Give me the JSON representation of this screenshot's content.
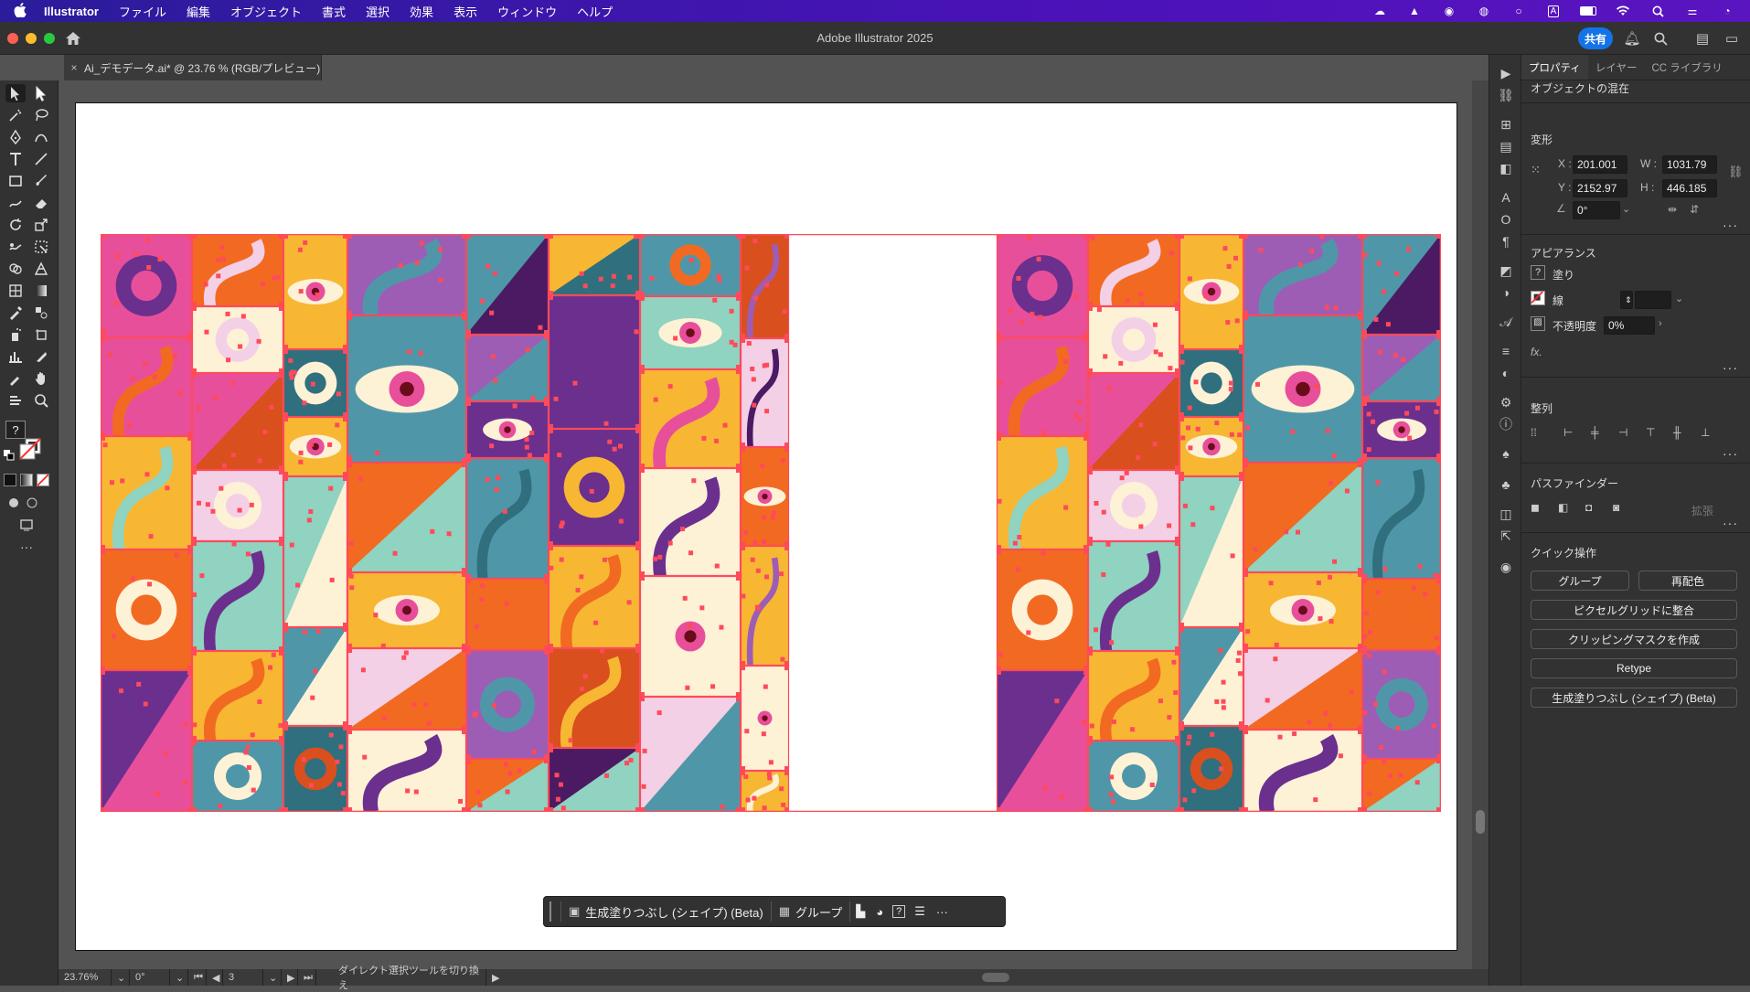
{
  "menubar": {
    "apple": "",
    "app_name": "Illustrator",
    "items": [
      "ファイル",
      "編集",
      "オブジェクト",
      "書式",
      "選択",
      "効果",
      "表示",
      "ウィンドウ",
      "ヘルプ"
    ]
  },
  "titlebar": {
    "title": "Adobe Illustrator 2025",
    "share_label": "共有"
  },
  "document_tab": {
    "close": "×",
    "name": "Ai_デモデータ.ai* @ 23.76 % (RGB/プレビュー)"
  },
  "context_bar": {
    "generative_fill": "生成塗りつぶし (シェイプ) (Beta)",
    "group": "グループ"
  },
  "status": {
    "zoom": "23.76%",
    "rotation": "0°",
    "artboard": "3",
    "tool_hint": "ダイレクト選択ツールを切り換え"
  },
  "panel": {
    "tabs": [
      "プロパティ",
      "レイヤー",
      "CC ライブラリ"
    ],
    "selection_type": "オブジェクトの混在",
    "transform": {
      "title": "変形",
      "x_label": "X :",
      "x_value": "201.001",
      "y_label": "Y :",
      "y_value": "2152.97",
      "w_label": "W :",
      "w_value": "1031.79",
      "h_label": "H :",
      "h_value": "446.185",
      "angle_value": "0°"
    },
    "appearance": {
      "title": "アピアランス",
      "fill_label": "塗り",
      "stroke_label": "線",
      "opacity_label": "不透明度",
      "opacity_value": "0%",
      "fx": "fx."
    },
    "align": {
      "title": "整列"
    },
    "pathfinder": {
      "title": "パスファインダー",
      "expand": "拡張"
    },
    "quick_actions": {
      "title": "クイック操作",
      "group": "グループ",
      "recolor": "再配色",
      "pixel_grid": "ピクセルグリッドに整合",
      "clipping_mask": "クリッピングマスクを作成",
      "retype": "Retype",
      "generative_fill": "生成塗りつぶし (シェイプ) (Beta)"
    }
  },
  "colors": {
    "accent": "#1473e6",
    "selection": "#ff4a5a",
    "orange": "#f26a21",
    "purple": "#6b2f8e",
    "teal": "#2f6f7e",
    "mint": "#8fd3c0",
    "yellow": "#f7b733",
    "cream": "#fdf1d6",
    "pink": "#e84f9a"
  }
}
